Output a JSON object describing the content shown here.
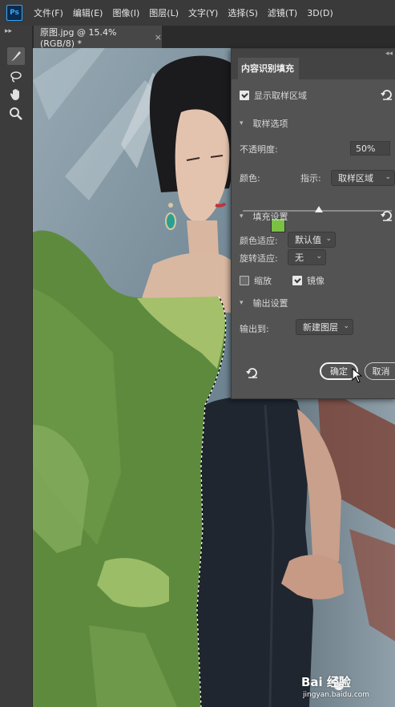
{
  "app": {
    "logo": "Ps"
  },
  "menu": [
    "文件(F)",
    "编辑(E)",
    "图像(I)",
    "图层(L)",
    "文字(Y)",
    "选择(S)",
    "滤镜(T)",
    "3D(D)"
  ],
  "document_tab": {
    "title": "原图.jpg @ 15.4%(RGB/8) *",
    "close": "×"
  },
  "tools": [
    "brush-icon",
    "lasso-icon",
    "hand-icon",
    "zoom-icon"
  ],
  "panel": {
    "title": "内容识别填充",
    "show_sampling_area": {
      "label": "显示取样区域",
      "checked": true
    },
    "sampling_section": "取样选项",
    "opacity_label": "不透明度:",
    "opacity_value": "50%",
    "opacity_level": 0.5,
    "color_label": "颜色:",
    "color_value": "#7ac143",
    "indicate_label": "指示:",
    "indicate_value": "取样区域",
    "fill_section": "填充设置",
    "color_adapt_label": "颜色适应:",
    "color_adapt_value": "默认值",
    "rotate_adapt_label": "旋转适应:",
    "rotate_adapt_value": "无",
    "scale": {
      "label": "缩放",
      "checked": false
    },
    "mirror": {
      "label": "镜像",
      "checked": true
    },
    "output_section": "输出设置",
    "output_label": "输出到:",
    "output_value": "新建图层",
    "ok_label": "确定",
    "cancel_label": "取消"
  },
  "watermark": {
    "text": "Bai 经验",
    "url": "jingyan.baidu.com"
  }
}
